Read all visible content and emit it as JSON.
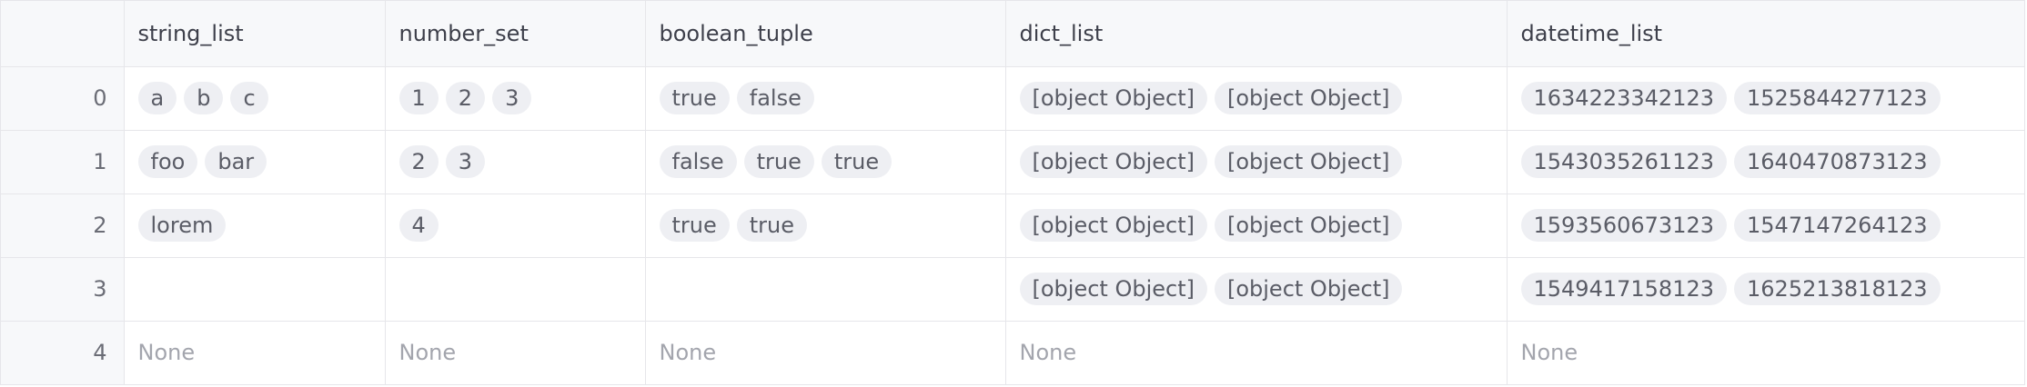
{
  "columns": [
    "",
    "string_list",
    "number_set",
    "boolean_tuple",
    "dict_list",
    "datetime_list"
  ],
  "rows": [
    {
      "index": "0",
      "cells": [
        [
          "a",
          "b",
          "c"
        ],
        [
          "1",
          "2",
          "3"
        ],
        [
          "true",
          "false"
        ],
        [
          "[object Object]",
          "[object Object]"
        ],
        [
          "1634223342123",
          "1525844277123"
        ]
      ]
    },
    {
      "index": "1",
      "cells": [
        [
          "foo",
          "bar"
        ],
        [
          "2",
          "3"
        ],
        [
          "false",
          "true",
          "true"
        ],
        [
          "[object Object]",
          "[object Object]"
        ],
        [
          "1543035261123",
          "1640470873123"
        ]
      ]
    },
    {
      "index": "2",
      "cells": [
        [
          "lorem"
        ],
        [
          "4"
        ],
        [
          "true",
          "true"
        ],
        [
          "[object Object]",
          "[object Object]"
        ],
        [
          "1593560673123",
          "1547147264123"
        ]
      ]
    },
    {
      "index": "3",
      "cells": [
        [],
        [],
        [],
        [
          "[object Object]",
          "[object Object]"
        ],
        [
          "1549417158123",
          "1625213818123"
        ]
      ]
    },
    {
      "index": "4",
      "cells": [
        "None",
        "None",
        "None",
        "None",
        "None"
      ]
    }
  ]
}
